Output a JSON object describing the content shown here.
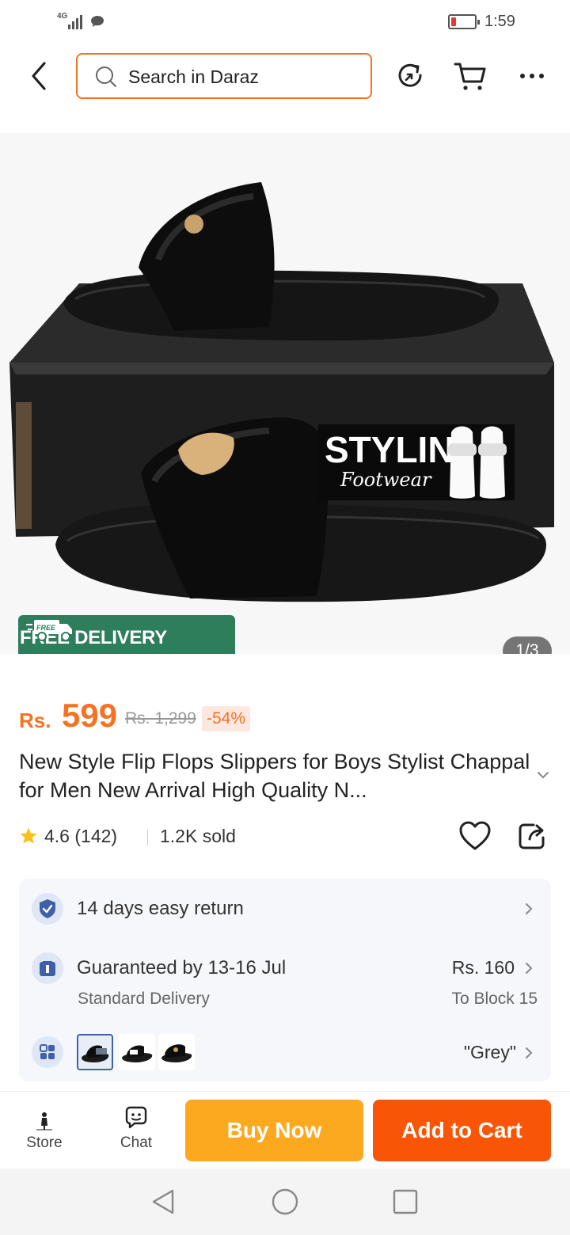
{
  "status_bar": {
    "network": "4G",
    "time": "1:59"
  },
  "header": {
    "search_placeholder": "Search in Daraz"
  },
  "gallery": {
    "brand_text": "STYLIN'",
    "brand_sub": "Footwear",
    "free_delivery_tag": "FREE",
    "free_delivery_label": "FREE DELIVERY",
    "counter": "1/3"
  },
  "price": {
    "currency": "Rs.",
    "amount": "599",
    "original": "Rs. 1,299",
    "discount": "-54%"
  },
  "product": {
    "title": "New Style Flip Flops Slippers for Boys Stylist Chappal for Men New Arrival High Quality N...",
    "rating": "4.6 (142)",
    "sold": "1.2K sold"
  },
  "info_card": {
    "return_policy": "14 days easy return",
    "delivery": {
      "guarantee": "Guaranteed by 13-16 Jul",
      "type": "Standard Delivery",
      "fee": "Rs. 160",
      "destination": "To Block 15"
    },
    "variant": {
      "selected": "\"Grey\""
    }
  },
  "bottom_bar": {
    "store_label": "Store",
    "chat_label": "Chat",
    "buy_now": "Buy Now",
    "add_to_cart": "Add to Cart"
  },
  "colors": {
    "accent": "#f57224",
    "cart": "#f85606",
    "buy": "#fca91f",
    "free_badge": "#2e7d5b"
  }
}
